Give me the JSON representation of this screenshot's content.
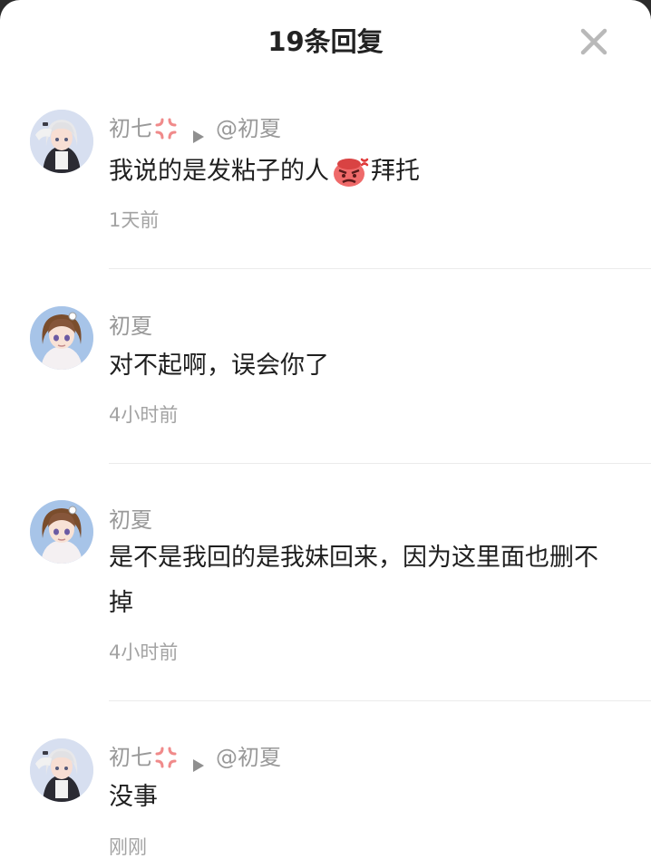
{
  "header": {
    "title": "19条回复",
    "close_icon": "close-icon"
  },
  "comments": [
    {
      "user": "初七",
      "user_badge_icon": "anger-symbol-icon",
      "reply_to": "@初夏",
      "text_before_emoji": "我说的是发粘子的人",
      "emoji_icon": "angry-face-emoji-icon",
      "text_after_emoji": "拜托",
      "time": "1天前"
    },
    {
      "user": "初夏",
      "text": "对不起啊，误会你了",
      "time": "4小时前"
    },
    {
      "user": "初夏",
      "text_line1": "是不是我回的是我妹回来，因为这里面也删不",
      "text_line2": "掉",
      "time": "4小时前"
    },
    {
      "user": "初七",
      "user_badge_icon": "anger-symbol-icon",
      "reply_to": "@初夏",
      "text": "没事",
      "time": "刚刚"
    }
  ],
  "colors": {
    "background": "#ffffff",
    "text": "#1f1f1f",
    "meta": "#999999",
    "divider": "#ebebeb"
  }
}
